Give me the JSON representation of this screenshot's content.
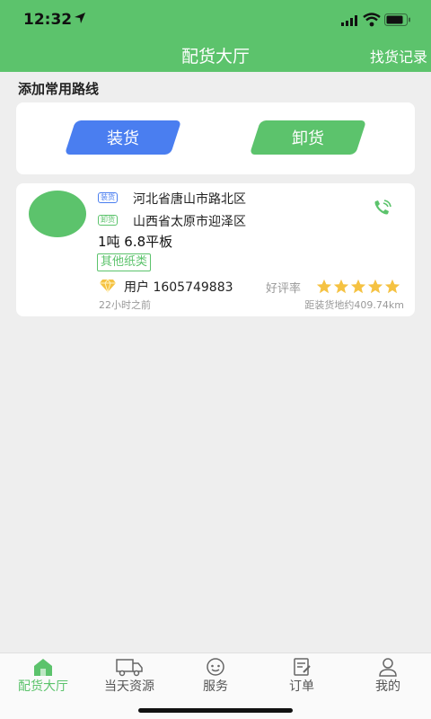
{
  "status": {
    "time": "12:32"
  },
  "nav": {
    "title": "配货大厅",
    "right_link": "找货记录"
  },
  "section": {
    "title": "添加常用路线"
  },
  "route_buttons": {
    "load": "装货",
    "unload": "卸货"
  },
  "cargo": {
    "load_tag": "装货",
    "unload_tag": "卸货",
    "from": "河北省唐山市路北区",
    "to": "山西省太原市迎泽区",
    "spec": "1吨 6.8平板",
    "category": "其他纸类",
    "user": "用户 1605749883",
    "rating_label": "好评率",
    "rating_stars": 5,
    "time_ago": "22小时之前",
    "distance": "距装货地约409.74km"
  },
  "tabs": [
    {
      "label": "配货大厅",
      "icon": "home-icon",
      "active": true
    },
    {
      "label": "当天资源",
      "icon": "truck-icon",
      "active": false
    },
    {
      "label": "服务",
      "icon": "service-icon",
      "active": false
    },
    {
      "label": "订单",
      "icon": "order-icon",
      "active": false
    },
    {
      "label": "我的",
      "icon": "profile-icon",
      "active": false
    }
  ],
  "colors": {
    "primary_green": "#5cc36c",
    "load_blue": "#4a7ef0"
  }
}
